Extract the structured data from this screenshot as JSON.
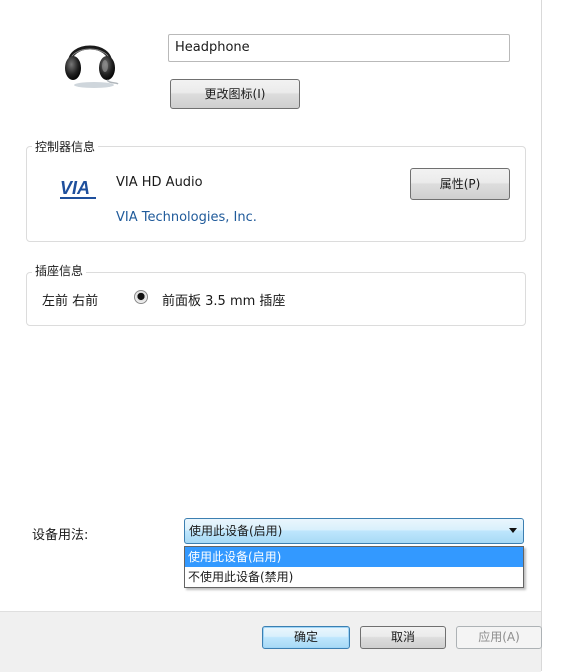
{
  "device": {
    "name_value": "Headphone",
    "change_icon_label": "更改图标(I)",
    "icon": "headphone-icon"
  },
  "controller": {
    "group_title": "控制器信息",
    "name": "VIA HD Audio",
    "vendor": "VIA Technologies, Inc.",
    "properties_label": "属性(P)",
    "logo": "via-logo",
    "logo_text": "VIA"
  },
  "jack": {
    "group_title": "插座信息",
    "position": "左前 右前",
    "description": "前面板 3.5 mm 插座"
  },
  "usage": {
    "label": "设备用法:",
    "selected": "使用此设备(启用)",
    "options": [
      "使用此设备(启用)",
      "不使用此设备(禁用)"
    ]
  },
  "footer": {
    "ok_label": "确定",
    "cancel_label": "取消",
    "apply_label": "应用(A)"
  },
  "colors": {
    "selection": "#3399ff",
    "vendor_text": "#1f5a9a",
    "via_logo_blue": "#1e4f9c"
  }
}
